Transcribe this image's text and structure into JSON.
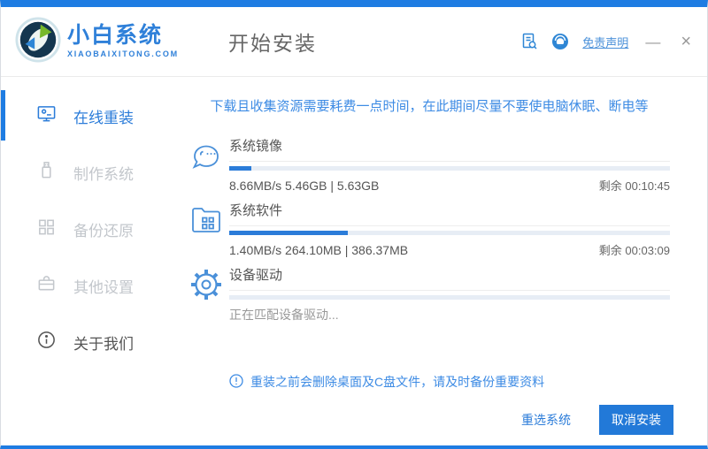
{
  "colors": {
    "accent": "#1e7ce2",
    "progress_fill": "#2b7cd9",
    "button_bg": "#2279d8",
    "link": "#4a90d9",
    "tip_text": "#3d8be4"
  },
  "brand": {
    "name": "小白系统",
    "domain": "XIAOBAIXITONG.COM",
    "logo_icon": "swirl-arrows-logo"
  },
  "header": {
    "title": "开始安装",
    "disclaimer_link": "免责声明",
    "icons": [
      "document-search-icon",
      "customer-service-icon"
    ],
    "minimize": "—",
    "close": "×"
  },
  "sidebar": {
    "items": [
      {
        "label": "在线重装",
        "icon": "monitor-reinstall-icon",
        "active": true
      },
      {
        "label": "制作系统",
        "icon": "usb-drive-icon",
        "active": false
      },
      {
        "label": "备份还原",
        "icon": "backup-blocks-icon",
        "active": false
      },
      {
        "label": "其他设置",
        "icon": "toolbox-icon",
        "active": false
      },
      {
        "label": "关于我们",
        "icon": "info-icon",
        "active": false
      }
    ]
  },
  "main": {
    "tip": "下载且收集资源需要耗费一点时间，在此期间尽量不要使电脑休眠、断电等",
    "tasks": [
      {
        "name": "系统镜像",
        "icon": "mascot-face-icon",
        "stats": "8.66MB/s 5.46GB | 5.63GB",
        "remaining": "剩余 00:10:45",
        "progress": 5
      },
      {
        "name": "系统软件",
        "icon": "software-folder-icon",
        "stats": "1.40MB/s 264.10MB | 386.37MB",
        "remaining": "剩余 00:03:09",
        "progress": 27
      },
      {
        "name": "设备驱动",
        "icon": "gear-icon",
        "stats": "正在匹配设备驱动...",
        "remaining": "",
        "progress": 0
      }
    ],
    "notice": "重装之前会删除桌面及C盘文件，请及时备份重要资料"
  },
  "footer": {
    "reselect_label": "重选系统",
    "cancel_label": "取消安装"
  }
}
